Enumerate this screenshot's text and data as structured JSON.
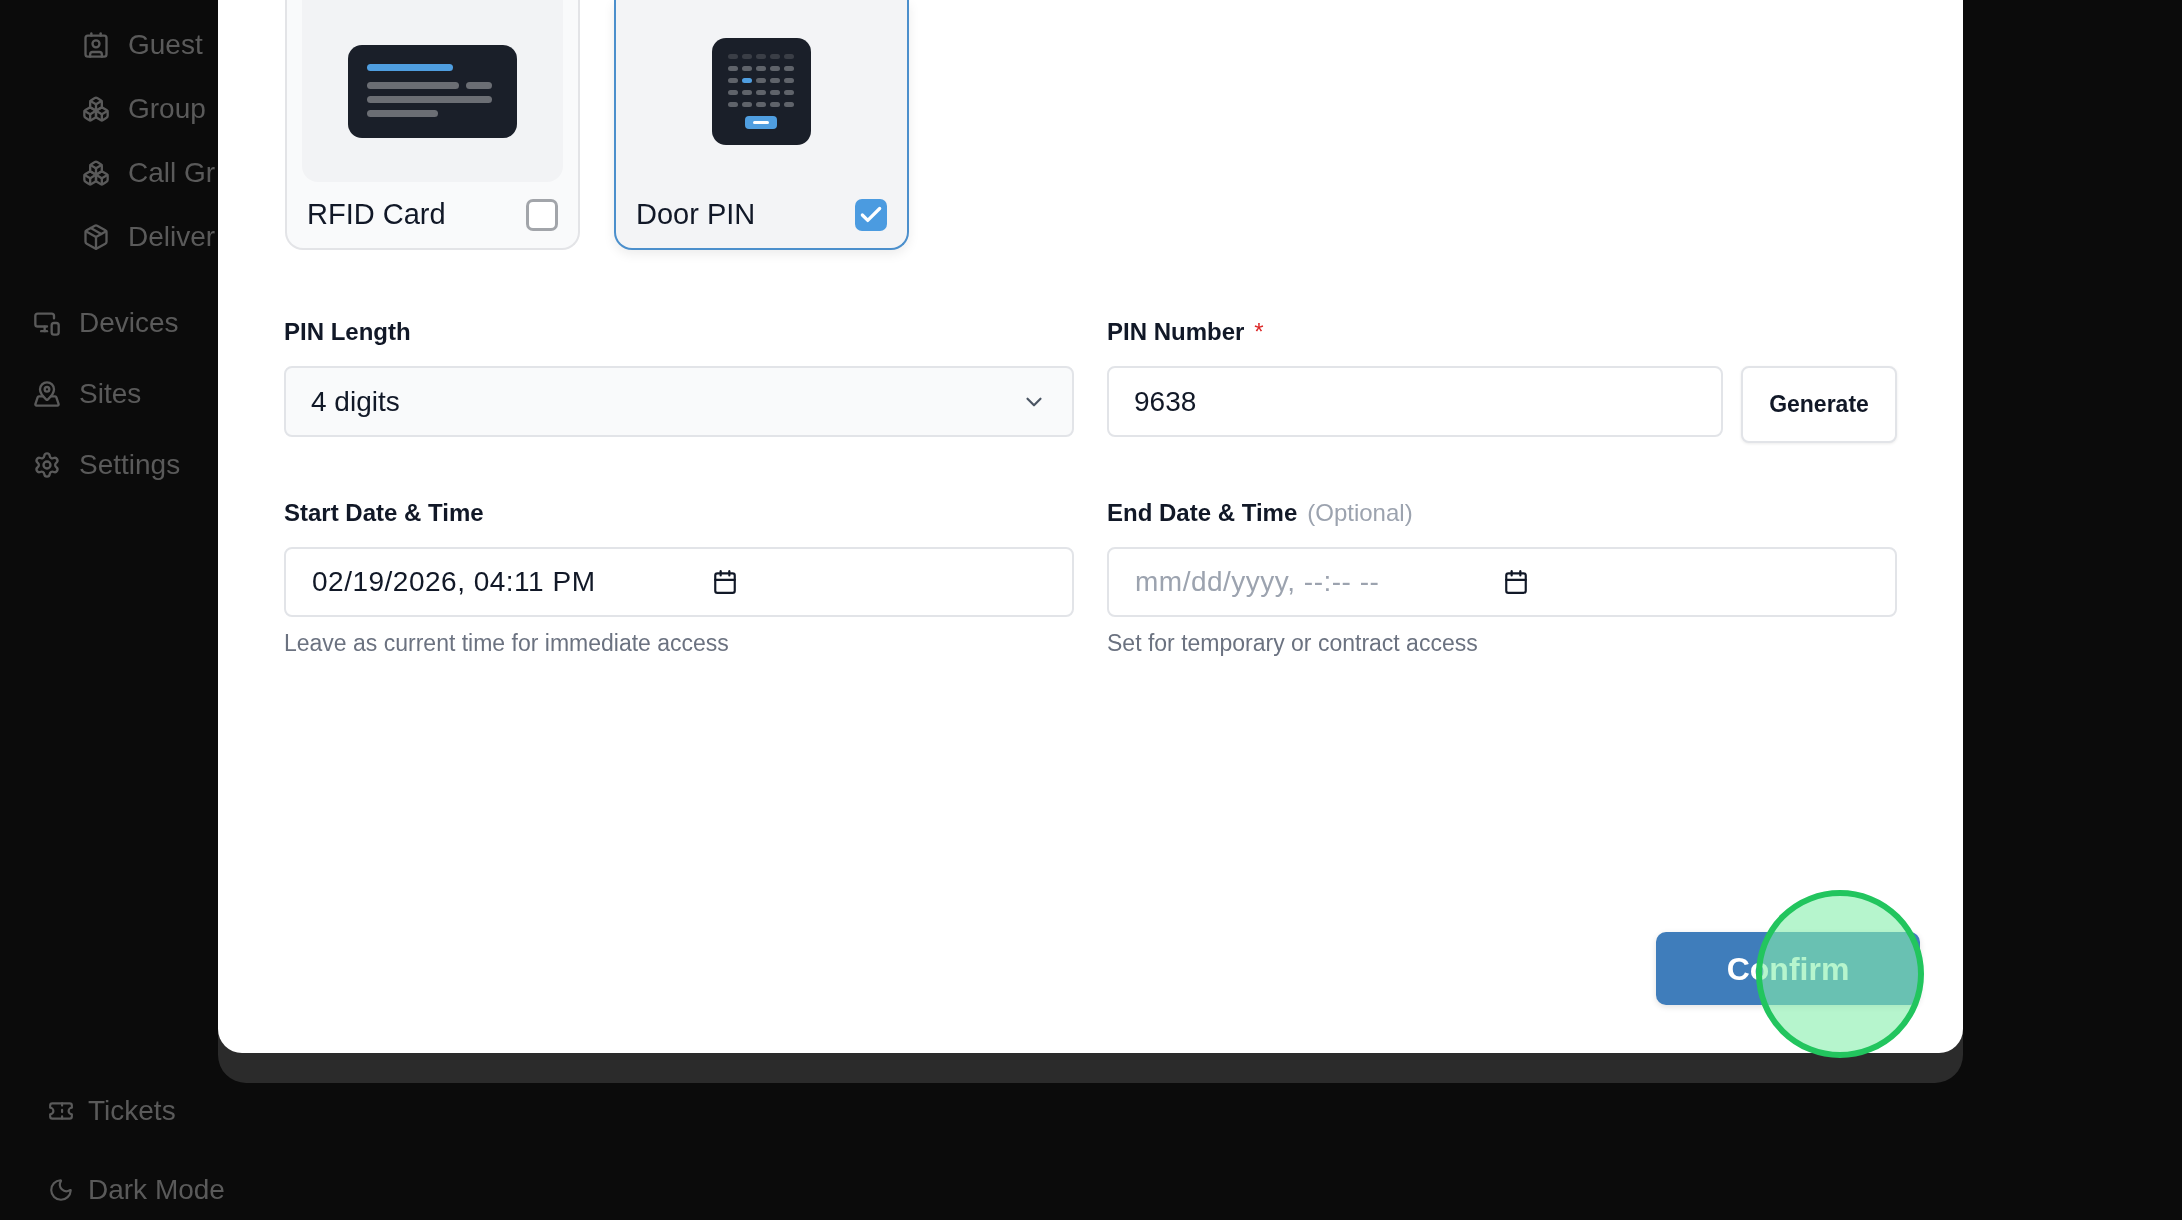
{
  "sidebar": {
    "sub_items": [
      {
        "label": "Guest",
        "kind": "guest"
      },
      {
        "label": "Group",
        "kind": "group"
      },
      {
        "label": "Call Gr",
        "kind": "group"
      },
      {
        "label": "Deliver",
        "kind": "box"
      }
    ],
    "items": [
      {
        "label": "Devices",
        "kind": "devices"
      },
      {
        "label": "Sites",
        "kind": "sites"
      },
      {
        "label": "Settings",
        "kind": "settings"
      }
    ],
    "footer": [
      {
        "label": "Tickets",
        "kind": "ticket"
      },
      {
        "label": "Dark Mode",
        "kind": "moon"
      }
    ]
  },
  "dialog": {
    "methods": [
      {
        "label": "RFID Card",
        "kind": "rfid",
        "selected": false
      },
      {
        "label": "Door PIN",
        "kind": "pin",
        "selected": true
      }
    ],
    "pin_length": {
      "label": "PIN Length",
      "value": "4 digits"
    },
    "pin_number": {
      "label": "PIN Number",
      "required_mark": "*",
      "value": "9638",
      "button": "Generate"
    },
    "start": {
      "label": "Start Date & Time",
      "value": "02/19/2026, 04:11 PM",
      "help": "Leave as current time for immediate access"
    },
    "end": {
      "label": "End Date & Time",
      "note": "(Optional)",
      "placeholder": "mm/dd/yyyy, --:-- --",
      "help": "Set for temporary or contract access"
    },
    "confirm": "Confirm"
  }
}
